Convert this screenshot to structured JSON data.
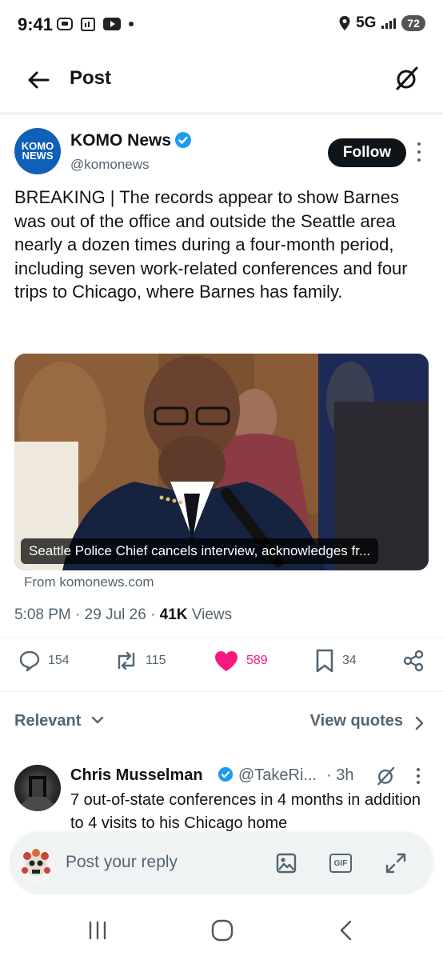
{
  "status_bar": {
    "time": "9:41",
    "network": "5G",
    "battery": "72"
  },
  "header": {
    "title": "Post"
  },
  "post": {
    "author_name": "KOMO News",
    "author_handle": "@komonews",
    "avatar_text_top": "KOMO",
    "avatar_text_bottom": "NEWS",
    "follow_label": "Follow",
    "text": "BREAKING | The records appear to show Barnes was out of the office and outside the Seattle area nearly a dozen times during a four-month period, including seven work-related conferences and four trips to Chicago, where Barnes has family.",
    "media_caption": "Seattle Police Chief cancels interview, acknowledges fr...",
    "source": "From komonews.com",
    "time": "5:08 PM",
    "date": "29 Jul 26",
    "views_count": "41K",
    "views_label": "Views",
    "reply_count": "154",
    "repost_count": "115",
    "like_count": "589",
    "bookmark_count": "34"
  },
  "replies_section": {
    "sort_label": "Relevant",
    "view_quotes_label": "View quotes"
  },
  "reply": {
    "name": "Chris Musselman",
    "handle": "@TakeRi...",
    "time": "3h",
    "text": "7 out-of-state conferences in 4 months in addition to 4 visits to his Chicago home"
  },
  "composer": {
    "placeholder": "Post your reply",
    "gif_label": "GIF"
  },
  "colors": {
    "like_pink": "#f91880",
    "verified_blue": "#1d9bf0",
    "secondary_text": "#536471"
  }
}
